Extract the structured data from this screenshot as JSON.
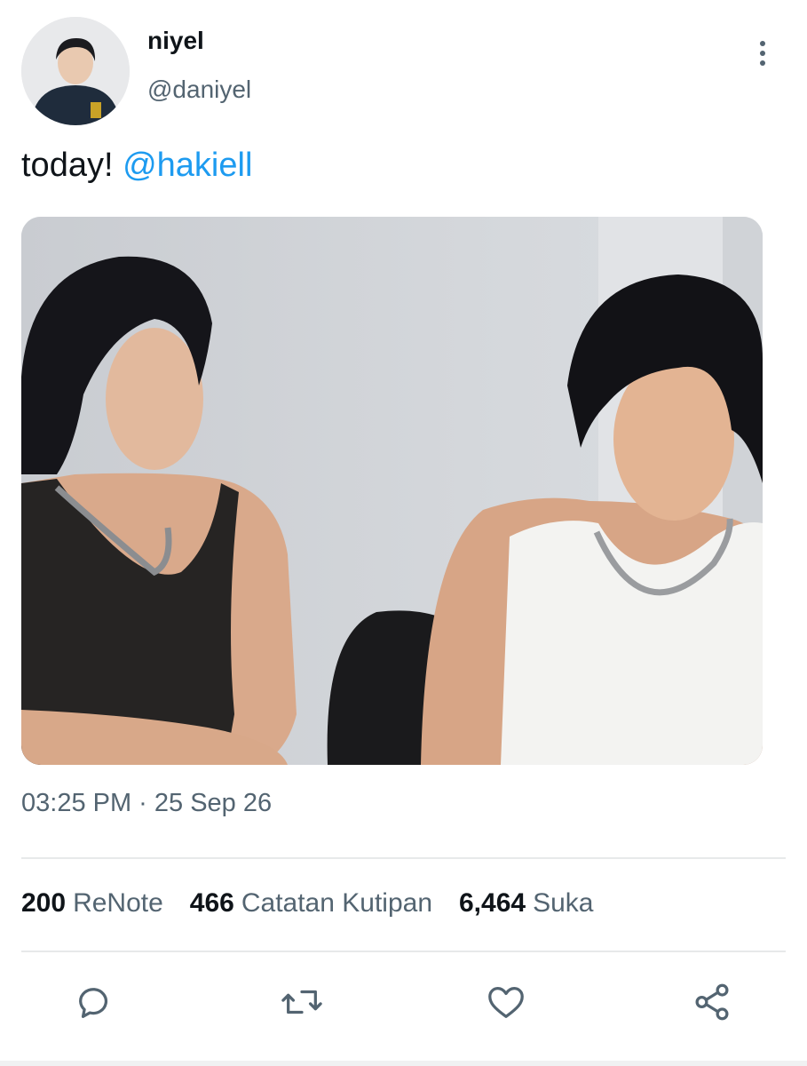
{
  "tweet": {
    "author_name": "niyel",
    "author_handle": "@daniyel",
    "text_prefix": "today! ",
    "mention": "@hakiell",
    "timestamp": "03:25 PM · 25 Sep 26"
  },
  "stats": {
    "renote_count": "200",
    "renote_label": "ReNote",
    "quote_count": "466",
    "quote_label": "Catatan Kutipan",
    "like_count": "6,464",
    "like_label": "Suka"
  },
  "icons": {
    "more": "more-vertical-icon",
    "reply": "reply-icon",
    "renote": "renote-icon",
    "like": "heart-icon",
    "share": "share-icon"
  },
  "colors": {
    "mention": "#1d9bf0",
    "secondary_text": "#536471",
    "primary_text": "#0f1419"
  }
}
